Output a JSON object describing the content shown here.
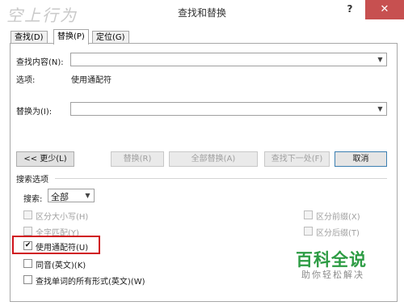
{
  "window": {
    "title": "查找和替换",
    "watermark": "空上行为",
    "help_glyph": "?",
    "close_glyph": "✕"
  },
  "tabs": [
    {
      "label": "查找(D)",
      "active": false
    },
    {
      "label": "替换(P)",
      "active": true
    },
    {
      "label": "定位(G)",
      "active": false
    }
  ],
  "find": {
    "label": "查找内容(N):",
    "value": "",
    "options_label": "选项:",
    "options_value": "使用通配符"
  },
  "replace": {
    "label": "替换为(I):",
    "value": ""
  },
  "buttons": {
    "less": "<< 更少(L)",
    "replace": "替换(R)",
    "replace_all": "全部替换(A)",
    "find_next": "查找下一处(F)",
    "cancel": "取消"
  },
  "search_options": {
    "section_label": "搜索选项",
    "search_label": "搜索:",
    "search_value": "全部",
    "match_case": "区分大小写(H)",
    "whole_word": "全字匹配(Y)",
    "wildcards": "使用通配符(U)",
    "sounds_like": "同音(英文)(K)",
    "all_forms": "查找单词的所有形式(英文)(W)",
    "match_prefix": "区分前缀(X)",
    "match_suffix": "区分后缀(T)",
    "checked_glyph": "✔"
  },
  "brand": {
    "name": "百科全说",
    "tagline": "助你轻松解决"
  },
  "colors": {
    "close_button": "#c75050",
    "highlight_border": "#d0141c",
    "brand": "#2d9c44"
  }
}
